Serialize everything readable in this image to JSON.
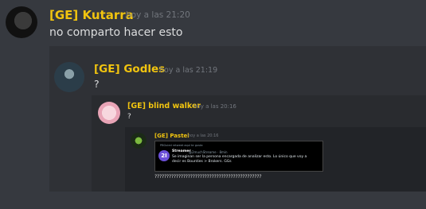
{
  "messages": {
    "level1": {
      "username": "[GE] Kutarra",
      "timestamp": "hoy a las 21:20",
      "text": "no comparto hacer esto"
    },
    "level2": {
      "username": "[GE] Godles",
      "timestamp": "hoy a las 21:19",
      "text": "?"
    },
    "level3": {
      "username": "[GE] blind walker",
      "timestamp": "hoy a las 20:16",
      "text": "?"
    },
    "level4": {
      "username": "[GE] Pastel",
      "timestamp": "hoy a las 20:16",
      "tweet": {
        "header": "PBGuied retweet aquí te gusta",
        "logo": "2I",
        "author": "Streamer",
        "handle": "@2muchStreame · 8min",
        "line1": "Se imaginan ser la persona encargada de analizar esto. Lo único que voy a",
        "line2": "decir es Bounties > Brokers. GGs"
      },
      "text": "?????????????????????????????????????????????"
    }
  },
  "icons": {
    "avatar1": "avatar-kutarra",
    "avatar2": "avatar-godles",
    "avatar3": "avatar-blind-walker",
    "avatar4": "avatar-pastel"
  },
  "colors": {
    "background": "#36393f",
    "username": "#f1c40f",
    "timestamp": "#72767d",
    "text": "#dcddde"
  }
}
